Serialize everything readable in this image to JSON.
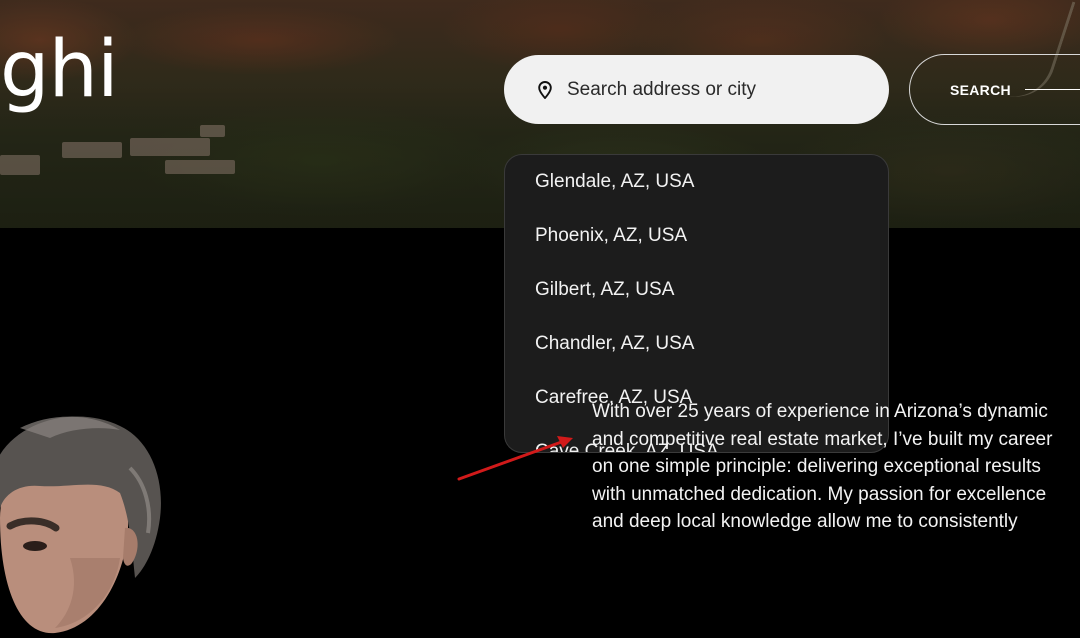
{
  "hero": {
    "title_fragment": "ghi"
  },
  "search": {
    "placeholder": "Search address or city",
    "button_label": "SEARCH",
    "icon": "map-pin-icon"
  },
  "dropdown": {
    "items": [
      "Glendale, AZ, USA",
      "Phoenix, AZ, USA",
      "Gilbert, AZ, USA",
      "Chandler, AZ, USA",
      "Carefree, AZ, USA",
      "Cave Creek, AZ, USA"
    ]
  },
  "bio": {
    "text": "With over 25 years of experience in Arizona’s dynamic and competitive real estate market, I’ve built my career on one simple principle: delivering exceptional results with unmatched dedication. My passion for excellence and deep local knowledge allow me to consistently"
  },
  "annotation": {
    "arrow_color": "#d11a1a"
  }
}
